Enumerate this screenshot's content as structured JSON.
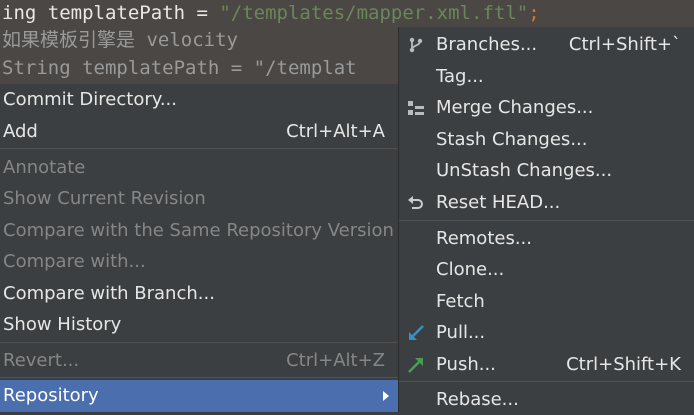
{
  "editor": {
    "line1_prefix": "ing templatePath = ",
    "line1_string": "\"/templates/mapper.xml.ftl\"",
    "line1_semi": ";",
    "line2_comment": "如果模板引擎是 velocity",
    "line3_text": "String templatePath = \"/templat"
  },
  "left_menu": {
    "items": [
      {
        "label": "Commit Directory...",
        "shortcut": "",
        "enabled": true
      },
      {
        "label": "Add",
        "shortcut": "Ctrl+Alt+A",
        "enabled": true
      },
      {
        "label": "Annotate",
        "shortcut": "",
        "enabled": false
      },
      {
        "label": "Show Current Revision",
        "shortcut": "",
        "enabled": false
      },
      {
        "label": "Compare with the Same Repository Version",
        "shortcut": "",
        "enabled": false
      },
      {
        "label": "Compare with...",
        "shortcut": "",
        "enabled": false
      },
      {
        "label": "Compare with Branch...",
        "shortcut": "",
        "enabled": true
      },
      {
        "label": "Show History",
        "shortcut": "",
        "enabled": true
      },
      {
        "label": "Revert...",
        "shortcut": "Ctrl+Alt+Z",
        "enabled": false
      },
      {
        "label": "Repository",
        "shortcut": "",
        "enabled": true,
        "selected": true
      }
    ]
  },
  "sub_menu": {
    "items": [
      {
        "label": "Branches...",
        "shortcut": "Ctrl+Shift+`",
        "icon": "branch-icon"
      },
      {
        "label": "Tag...",
        "shortcut": ""
      },
      {
        "label": "Merge Changes...",
        "shortcut": "",
        "icon": "merge-icon"
      },
      {
        "label": "Stash Changes...",
        "shortcut": ""
      },
      {
        "label": "UnStash Changes...",
        "shortcut": ""
      },
      {
        "label": "Reset HEAD...",
        "shortcut": "",
        "icon": "reset-icon"
      },
      {
        "label": "Remotes...",
        "shortcut": ""
      },
      {
        "label": "Clone...",
        "shortcut": ""
      },
      {
        "label": "Fetch",
        "shortcut": ""
      },
      {
        "label": "Pull...",
        "shortcut": "",
        "icon": "pull-icon"
      },
      {
        "label": "Push...",
        "shortcut": "Ctrl+Shift+K",
        "icon": "push-icon"
      },
      {
        "label": "Rebase...",
        "shortcut": ""
      }
    ]
  },
  "colors": {
    "menu_bg": "#3c3f41",
    "selection": "#4b6eaf",
    "pull_icon": "#3592c4",
    "push_icon": "#499c54"
  }
}
